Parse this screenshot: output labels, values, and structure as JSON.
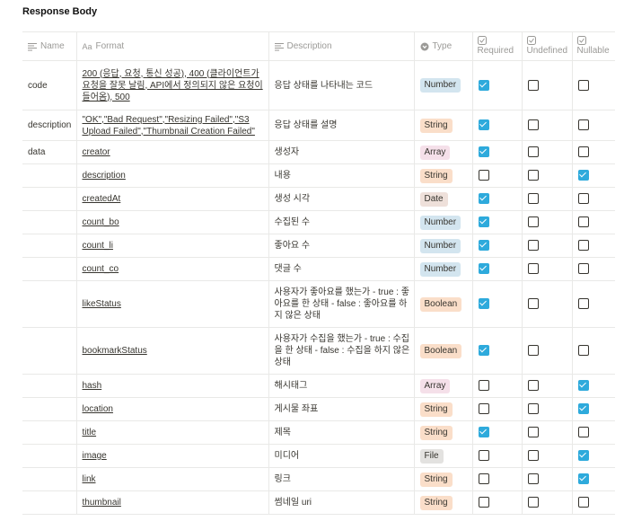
{
  "section_title": "Response Body",
  "headers": {
    "name": "Name",
    "format": "Format",
    "description": "Description",
    "type": "Type",
    "required": "Required",
    "undefined": "Undefined",
    "nullable": "Nullable"
  },
  "rows": [
    {
      "name": "code",
      "format": "200 (응답, 요청, 통신 성공), 400 (클라이언트가 요청을 잘못 날림, API에서 정의되지 않은 요청이 들어옴), 500",
      "description": "응답 상태를 나타내는 코드",
      "type": "Number",
      "required": true,
      "undefined": false,
      "nullable": false
    },
    {
      "name": "description",
      "format": "\"OK\",\"Bad Request\",\"Resizing Failed\",\"S3 Upload Failed\",\"Thumbnail Creation Failed\"",
      "description": "응답 상태를 설명",
      "type": "String",
      "required": true,
      "undefined": false,
      "nullable": false
    },
    {
      "name": "data",
      "format": "creator",
      "description": "생성자",
      "type": "Array",
      "required": true,
      "undefined": false,
      "nullable": false
    },
    {
      "name": "",
      "format": "description",
      "description": "내용",
      "type": "String",
      "required": false,
      "undefined": false,
      "nullable": true
    },
    {
      "name": "",
      "format": "createdAt",
      "description": "생성 시각",
      "type": "Date",
      "required": true,
      "undefined": false,
      "nullable": false
    },
    {
      "name": "",
      "format": "count_bo",
      "description": "수집된 수",
      "type": "Number",
      "required": true,
      "undefined": false,
      "nullable": false
    },
    {
      "name": "",
      "format": "count_li",
      "description": "좋아요 수",
      "type": "Number",
      "required": true,
      "undefined": false,
      "nullable": false
    },
    {
      "name": "",
      "format": "count_co",
      "description": "댓글 수",
      "type": "Number",
      "required": true,
      "undefined": false,
      "nullable": false
    },
    {
      "name": "",
      "format": "likeStatus",
      "description": "사용자가 좋아요를 했는가 - true : 좋아요를 한 상태 - false : 좋아요를 하지 않은 상태",
      "type": "Boolean",
      "required": true,
      "undefined": false,
      "nullable": false
    },
    {
      "name": "",
      "format": "bookmarkStatus",
      "description": "사용자가 수집을 했는가 - true : 수집을 한 상태 - false : 수집을 하지 않은 상태",
      "type": "Boolean",
      "required": true,
      "undefined": false,
      "nullable": false
    },
    {
      "name": "",
      "format": "hash",
      "description": "해시태그",
      "type": "Array",
      "required": false,
      "undefined": false,
      "nullable": true
    },
    {
      "name": "",
      "format": "location",
      "description": "게시물 좌표",
      "type": "String",
      "required": false,
      "undefined": false,
      "nullable": true
    },
    {
      "name": "",
      "format": "title",
      "description": "제목",
      "type": "String",
      "required": true,
      "undefined": false,
      "nullable": false
    },
    {
      "name": "",
      "format": "image",
      "description": "미디어",
      "type": "File",
      "required": false,
      "undefined": false,
      "nullable": true
    },
    {
      "name": "",
      "format": "link",
      "description": "링크",
      "type": "String",
      "required": false,
      "undefined": false,
      "nullable": true
    },
    {
      "name": "",
      "format": "thumbnail",
      "description": "썸네일 uri",
      "type": "String",
      "required": false,
      "undefined": false,
      "nullable": false
    }
  ]
}
